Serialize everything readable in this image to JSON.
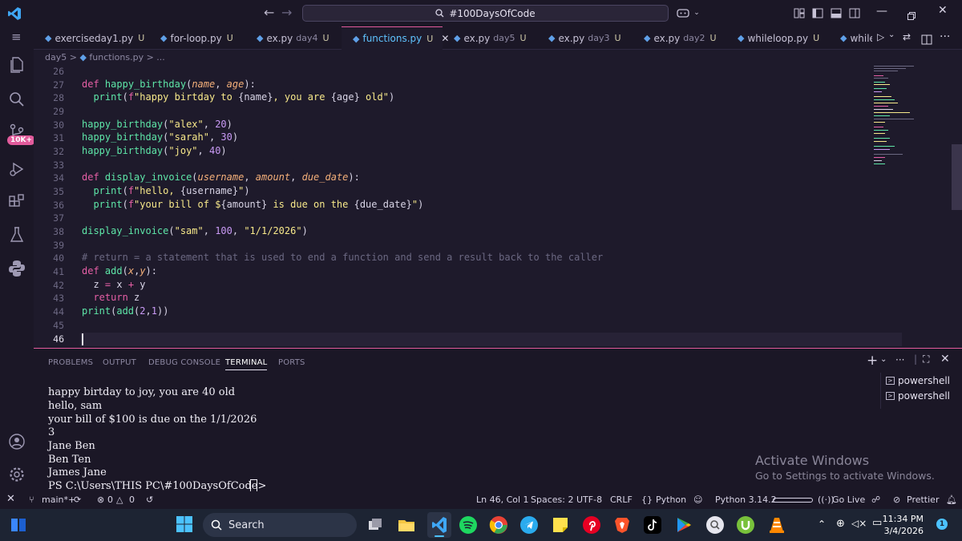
{
  "titlebar": {
    "search_text": "#100DaysOfCode"
  },
  "activity_bar": {
    "badge": "10K+"
  },
  "tabs": [
    {
      "name": "exerciseday1.py",
      "dir": "",
      "status": "U"
    },
    {
      "name": "for-loop.py",
      "dir": "",
      "status": "U"
    },
    {
      "name": "ex.py",
      "dir": "day4",
      "status": "U"
    },
    {
      "name": "functions.py",
      "dir": "",
      "status": "U",
      "close": "✕"
    },
    {
      "name": "ex.py",
      "dir": "day5",
      "status": "U"
    },
    {
      "name": "ex.py",
      "dir": "day3",
      "status": "U"
    },
    {
      "name": "ex.py",
      "dir": "day2",
      "status": "U"
    },
    {
      "name": "whileloop.py",
      "dir": "",
      "status": "U"
    },
    {
      "name": "while",
      "dir": "",
      "status": ""
    }
  ],
  "breadcrumb": {
    "folder": "day5",
    "file": "functions.py",
    "ellipsis": "..."
  },
  "editor": {
    "line_numbers": [
      "26",
      "27",
      "28",
      "29",
      "30",
      "31",
      "32",
      "33",
      "34",
      "35",
      "36",
      "37",
      "38",
      "39",
      "40",
      "41",
      "42",
      "43",
      "44",
      "45",
      "46"
    ],
    "current_line": "46"
  },
  "panel": {
    "tabs": [
      "PROBLEMS",
      "OUTPUT",
      "DEBUG CONSOLE",
      "TERMINAL",
      "PORTS"
    ],
    "active_tab": "TERMINAL",
    "terminal_lines": [
      "happy birtday to joy, you are 40 old",
      "hello, sam",
      "your bill of $100 is due on the 1/1/2026",
      "3",
      "Jane Ben",
      "Ben Ten",
      "James Jane",
      "PS C:\\Users\\THIS PC\\#100DaysOfCode> "
    ],
    "shells": [
      "powershell",
      "powershell"
    ],
    "add_label": "+"
  },
  "watermark": {
    "line1": "Activate Windows",
    "line2": "Go to Settings to activate Windows."
  },
  "statusbar": {
    "branch": "main*+",
    "errors": "0",
    "warnings": "0",
    "position": "Ln 46, Col 1",
    "spaces": "Spaces: 2",
    "encoding": "UTF-8",
    "eol": "CRLF",
    "language": "Python",
    "interpreter": "Python 3.14.2",
    "golive": "Go Live",
    "prettier": "Prettier"
  },
  "taskbar": {
    "search_label": "Search",
    "time": "11:34 PM",
    "date": "3/4/2026",
    "notification_count": "1"
  },
  "colors": {
    "accent": "#e25b9c",
    "keyword": "#e65fa6",
    "function": "#5ee6a8",
    "string": "#f7e88a"
  }
}
